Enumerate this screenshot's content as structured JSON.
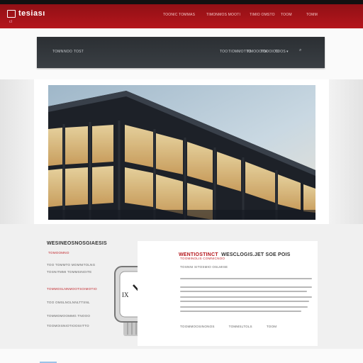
{
  "header": {
    "logo_text": "tesiası",
    "logo_sub": "cl",
    "nav": [
      "TOONIC TOMMAS",
      "TIMONMOS MOOTI",
      "TIMIO OMSTO",
      "TOOM",
      "TOMM"
    ]
  },
  "subnav": {
    "left": [
      "TOMN",
      "NOO",
      "TOST"
    ],
    "right": [
      "TOO",
      "TIOMMOTTO",
      "TIMOOOTM",
      "TOOOIOO",
      "TOOS",
      "▾",
      "⌕"
    ]
  },
  "left_card": {
    "title": "WESINEOSNOSGIAESIS",
    "tag": "TOMOOMNO",
    "lines": [
      {
        "text": "TOO TOMMTO MOMNITOLNG",
        "red": false
      },
      {
        "text": "TOSNITMMI TOMMSINOITE",
        "red": false
      },
      {
        "text": "TOMMOSLNNMOOTSOIMOTIO",
        "red": true
      },
      {
        "text": "TOO OMSLNGLNNLTTSNL",
        "red": false
      },
      {
        "text": "TOMMOMOOMMG TNOOO",
        "red": false
      },
      {
        "text": "TOOMOISNIOTIOOSIITTO",
        "red": false
      }
    ]
  },
  "right_card": {
    "title_red": "WENTIOSTINCT",
    "title_dark": "WESCLOGIS.JET SOE POIS",
    "sub": "TOOMINOLIS COMNICNOO",
    "sub2": "TOSNNI SITOSMIO OSLMISE",
    "paragraph_rows": 7,
    "links": [
      "TOOMMOOSINONOS",
      "TOMMSLTOLS",
      "TOOM"
    ]
  },
  "colors": {
    "brand": "#b5161c",
    "dark_bar": "#2f3438"
  },
  "icons": {
    "logo": "tv-icon",
    "search": "search-icon",
    "watch": "watch-icon"
  }
}
